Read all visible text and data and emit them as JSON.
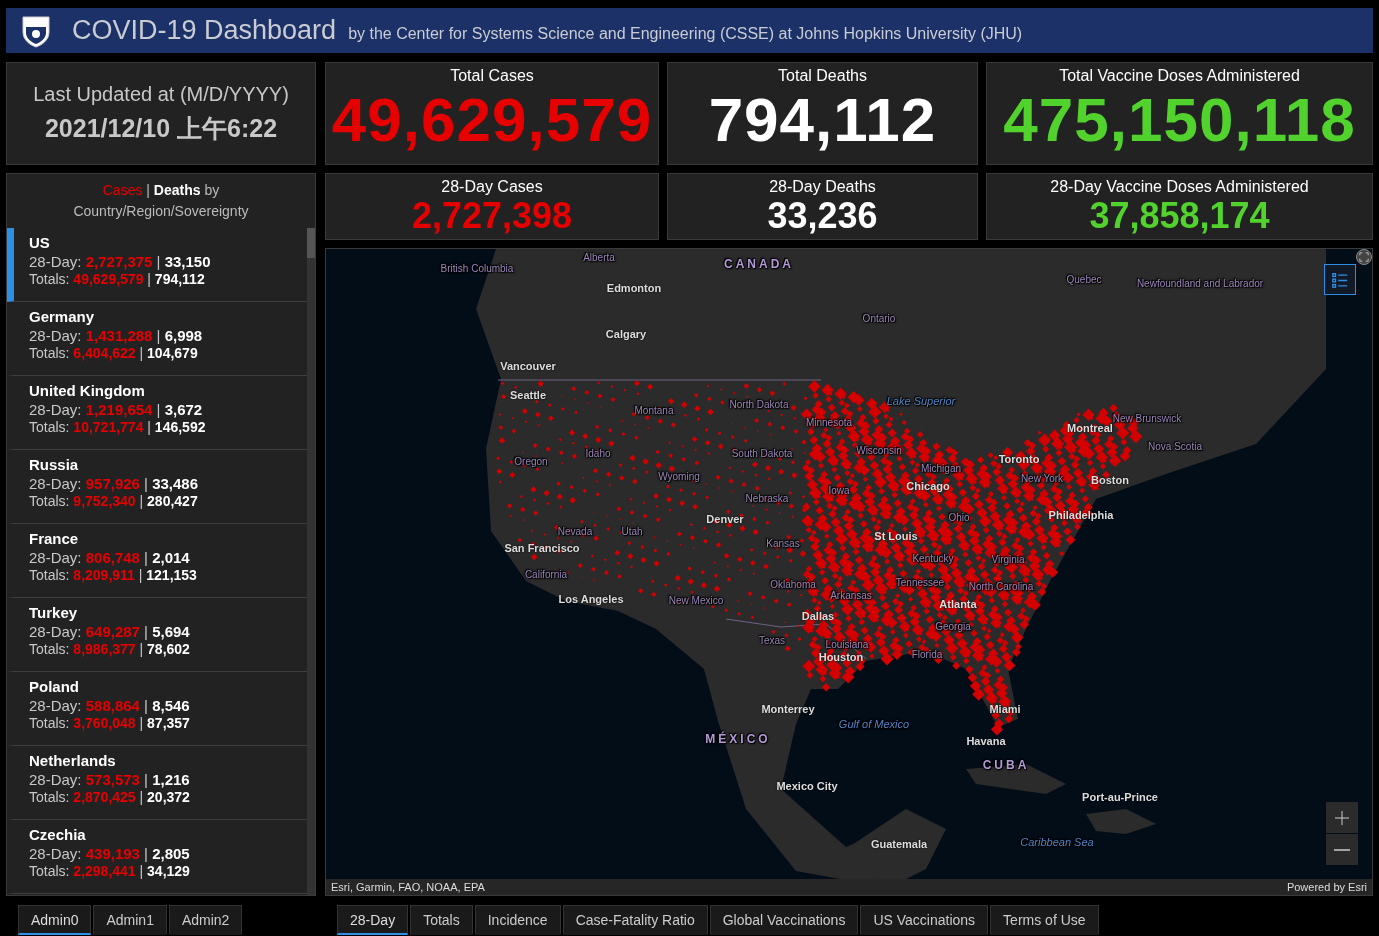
{
  "header": {
    "title": "COVID-19 Dashboard",
    "subtitle": "by the Center for Systems Science and Engineering (CSSE) at Johns Hopkins University (JHU)"
  },
  "last_updated": {
    "label": "Last Updated at (M/D/YYYY)",
    "value": "2021/12/10 上午6:22"
  },
  "totals": [
    {
      "kind": "cases",
      "title": "Total Cases",
      "value": "49,629,579"
    },
    {
      "kind": "deaths",
      "title": "Total Deaths",
      "value": "794,112"
    },
    {
      "kind": "vaccines",
      "title": "Total Vaccine Doses Administered",
      "value": "475,150,118"
    }
  ],
  "recent": [
    {
      "kind": "cases",
      "title": "28-Day Cases",
      "value": "2,727,398"
    },
    {
      "kind": "deaths",
      "title": "28-Day Deaths",
      "value": "33,236"
    },
    {
      "kind": "vaccines",
      "title": "28-Day Vaccine Doses Administered",
      "value": "37,858,174"
    }
  ],
  "country_list": {
    "heading_cases": "Cases",
    "separator": "|",
    "heading_deaths": "Deaths",
    "heading_suffix": "by Country/Region/Sovereignty",
    "items": [
      {
        "name": "US",
        "day28_label": "28-Day:",
        "totals_label": "Totals:",
        "day28_cases": "2,727,375",
        "day28_deaths": "33,150",
        "total_cases": "49,629,579",
        "total_deaths": "794,112",
        "selected": true
      },
      {
        "name": "Germany",
        "day28_label": "28-Day:",
        "totals_label": "Totals:",
        "day28_cases": "1,431,288",
        "day28_deaths": "6,998",
        "total_cases": "6,404,622",
        "total_deaths": "104,679",
        "selected": false
      },
      {
        "name": "United Kingdom",
        "day28_label": "28-Day:",
        "totals_label": "Totals:",
        "day28_cases": "1,219,654",
        "day28_deaths": "3,672",
        "total_cases": "10,721,774",
        "total_deaths": "146,592",
        "selected": false
      },
      {
        "name": "Russia",
        "day28_label": "28-Day:",
        "totals_label": "Totals:",
        "day28_cases": "957,926",
        "day28_deaths": "33,486",
        "total_cases": "9,752,340",
        "total_deaths": "280,427",
        "selected": false
      },
      {
        "name": "France",
        "day28_label": "28-Day:",
        "totals_label": "Totals:",
        "day28_cases": "806,748",
        "day28_deaths": "2,014",
        "total_cases": "8,209,911",
        "total_deaths": "121,153",
        "selected": false
      },
      {
        "name": "Turkey",
        "day28_label": "28-Day:",
        "totals_label": "Totals:",
        "day28_cases": "649,287",
        "day28_deaths": "5,694",
        "total_cases": "8,986,377",
        "total_deaths": "78,602",
        "selected": false
      },
      {
        "name": "Poland",
        "day28_label": "28-Day:",
        "totals_label": "Totals:",
        "day28_cases": "588,864",
        "day28_deaths": "8,546",
        "total_cases": "3,760,048",
        "total_deaths": "87,357",
        "selected": false
      },
      {
        "name": "Netherlands",
        "day28_label": "28-Day:",
        "totals_label": "Totals:",
        "day28_cases": "573,573",
        "day28_deaths": "1,216",
        "total_cases": "2,870,425",
        "total_deaths": "20,372",
        "selected": false
      },
      {
        "name": "Czechia",
        "day28_label": "28-Day:",
        "totals_label": "Totals:",
        "day28_cases": "439,193",
        "day28_deaths": "2,805",
        "total_cases": "2,298,441",
        "total_deaths": "34,129",
        "selected": false
      }
    ]
  },
  "map": {
    "attribution": "Esri, Garmin, FAO, NOAA, EPA",
    "powered_by": "Powered by Esri",
    "labels": [
      {
        "kind": "region",
        "text": "British Columbia"
      },
      {
        "kind": "region",
        "text": "Alberta"
      },
      {
        "kind": "country",
        "text": "CANADA"
      },
      {
        "kind": "city",
        "text": "Edmonton"
      },
      {
        "kind": "city",
        "text": "Calgary"
      },
      {
        "kind": "city",
        "text": "Vancouver"
      },
      {
        "kind": "city",
        "text": "Seattle"
      },
      {
        "kind": "region",
        "text": "Montana"
      },
      {
        "kind": "region",
        "text": "North Dakota"
      },
      {
        "kind": "region",
        "text": "Minnesota"
      },
      {
        "kind": "region",
        "text": "Idaho"
      },
      {
        "kind": "region",
        "text": "Oregon"
      },
      {
        "kind": "region",
        "text": "South Dakota"
      },
      {
        "kind": "region",
        "text": "Wyoming"
      },
      {
        "kind": "region",
        "text": "Nebraska"
      },
      {
        "kind": "region",
        "text": "Iowa"
      },
      {
        "kind": "city",
        "text": "Denver"
      },
      {
        "kind": "region",
        "text": "Nevada"
      },
      {
        "kind": "region",
        "text": "Utah"
      },
      {
        "kind": "city",
        "text": "San Francisco"
      },
      {
        "kind": "region",
        "text": "Kansas"
      },
      {
        "kind": "region",
        "text": "California"
      },
      {
        "kind": "city",
        "text": "Los Angeles"
      },
      {
        "kind": "region",
        "text": "New Mexico"
      },
      {
        "kind": "region",
        "text": "Oklahoma"
      },
      {
        "kind": "city",
        "text": "Dallas"
      },
      {
        "kind": "region",
        "text": "Arkansas"
      },
      {
        "kind": "region",
        "text": "Texas"
      },
      {
        "kind": "region",
        "text": "Louisiana"
      },
      {
        "kind": "city",
        "text": "Houston"
      },
      {
        "kind": "city",
        "text": "Monterrey"
      },
      {
        "kind": "country",
        "text": "MÉXICO"
      },
      {
        "kind": "city",
        "text": "Mexico City"
      },
      {
        "kind": "region",
        "text": "Ontario"
      },
      {
        "kind": "region",
        "text": "Quebec"
      },
      {
        "kind": "region",
        "text": "Newfoundland and Labrador"
      },
      {
        "kind": "water",
        "text": "Lake Superior"
      },
      {
        "kind": "region",
        "text": "Wisconsin"
      },
      {
        "kind": "region",
        "text": "Michigan"
      },
      {
        "kind": "city",
        "text": "Chicago"
      },
      {
        "kind": "city",
        "text": "Montreal"
      },
      {
        "kind": "region",
        "text": "New Brunswick"
      },
      {
        "kind": "region",
        "text": "Nova Scotia"
      },
      {
        "kind": "city",
        "text": "Toronto"
      },
      {
        "kind": "region",
        "text": "New York"
      },
      {
        "kind": "city",
        "text": "Boston"
      },
      {
        "kind": "region",
        "text": "Ohio"
      },
      {
        "kind": "city",
        "text": "Philadelphia"
      },
      {
        "kind": "city",
        "text": "St Louis"
      },
      {
        "kind": "region",
        "text": "Kentucky"
      },
      {
        "kind": "region",
        "text": "Virginia"
      },
      {
        "kind": "region",
        "text": "Tennessee"
      },
      {
        "kind": "region",
        "text": "North Carolina"
      },
      {
        "kind": "city",
        "text": "Atlanta"
      },
      {
        "kind": "region",
        "text": "Georgia"
      },
      {
        "kind": "region",
        "text": "Florida"
      },
      {
        "kind": "water",
        "text": "Gulf of Mexico"
      },
      {
        "kind": "city",
        "text": "Miami"
      },
      {
        "kind": "city",
        "text": "Havana"
      },
      {
        "kind": "country",
        "text": "CUBA"
      },
      {
        "kind": "city",
        "text": "Port-au-Prince"
      },
      {
        "kind": "water",
        "text": "Caribbean Sea"
      },
      {
        "kind": "city",
        "text": "Guatemala"
      }
    ]
  },
  "admin_tabs": [
    {
      "label": "Admin0",
      "selected": true
    },
    {
      "label": "Admin1",
      "selected": false
    },
    {
      "label": "Admin2",
      "selected": false
    }
  ],
  "map_tabs": [
    {
      "label": "28-Day",
      "selected": true
    },
    {
      "label": "Totals",
      "selected": false
    },
    {
      "label": "Incidence",
      "selected": false
    },
    {
      "label": "Case-Fatality Ratio",
      "selected": false
    },
    {
      "label": "Global Vaccinations",
      "selected": false
    },
    {
      "label": "US Vaccinations",
      "selected": false
    },
    {
      "label": "Terms of Use",
      "selected": false
    }
  ]
}
